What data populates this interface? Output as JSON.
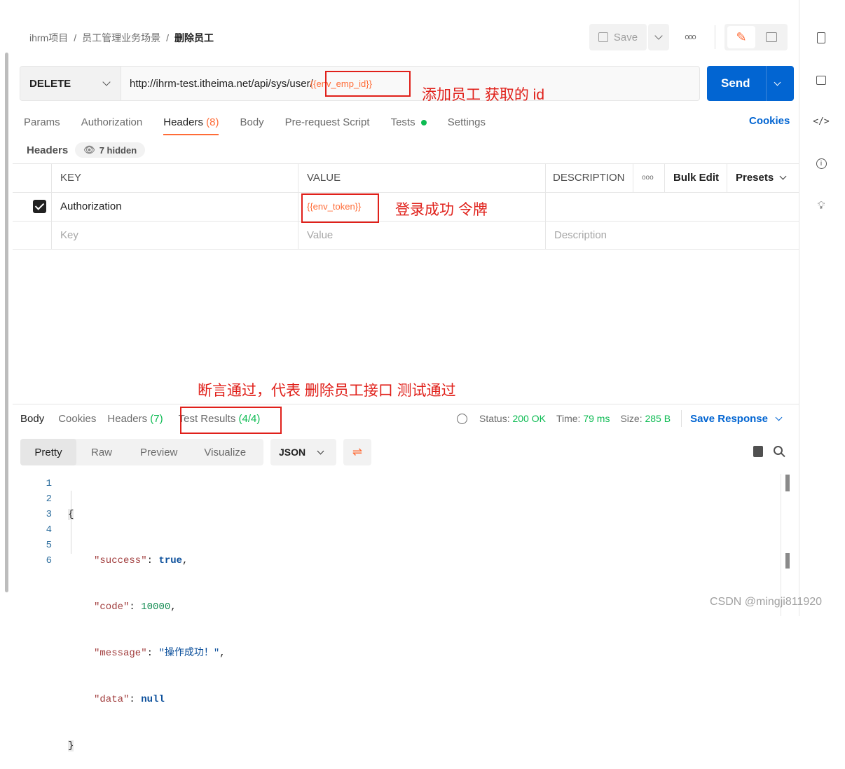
{
  "breadcrumb": {
    "p1": "ihrm项目",
    "sep": "/",
    "p2": "员工管理业务场景",
    "p3": "删除员工"
  },
  "toolbar": {
    "save": "Save",
    "more": "ooo"
  },
  "request": {
    "method": "DELETE",
    "url_base": "http://ihrm-test.itheima.net/api/sys/user/",
    "url_var": "{{env_emp_id}}",
    "send": "Send"
  },
  "annotations": {
    "id_note": "添加员工 获取的 id",
    "token_note": "登录成功 令牌",
    "test_note": "断言通过，代表 删除员工接口 测试通过"
  },
  "req_tabs": [
    "Params",
    "Authorization",
    "Headers",
    "(8)",
    "Body",
    "Pre-request Script",
    "Tests",
    "Settings"
  ],
  "cookies": "Cookies",
  "headers_bar": {
    "label": "Headers",
    "hidden": "7 hidden"
  },
  "table": {
    "key": "KEY",
    "value": "VALUE",
    "description": "DESCRIPTION",
    "more": "ooo",
    "bulk": "Bulk Edit",
    "presets": "Presets",
    "row_key": "Authorization",
    "row_value": "{{env_token}}",
    "ph_key": "Key",
    "ph_value": "Value",
    "ph_desc": "Description"
  },
  "resp_tabs": {
    "body": "Body",
    "cookies": "Cookies",
    "headers": "Headers",
    "headers_count": "(7)",
    "tests": "Test Results",
    "tests_count": "(4/4)"
  },
  "status": {
    "status_label": "Status:",
    "status": "200 OK",
    "time_label": "Time:",
    "time": "79 ms",
    "size_label": "Size:",
    "size": "285 B",
    "save_response": "Save Response"
  },
  "view_tabs": {
    "pretty": "Pretty",
    "raw": "Raw",
    "preview": "Preview",
    "visualize": "Visualize",
    "format": "JSON"
  },
  "code": {
    "lines": [
      "1",
      "2",
      "3",
      "4",
      "5",
      "6"
    ],
    "open": "{",
    "k1": "\"success\"",
    "v1": "true",
    "k2": "\"code\"",
    "v2": "10000",
    "k3": "\"message\"",
    "v3": "\"操作成功！\"",
    "k4": "\"data\"",
    "v4": "null",
    "close": "}"
  },
  "watermark": "CSDN @mingji811920",
  "colors": {
    "accent": "#ff6c37",
    "send": "#0265d2",
    "annotation": "#e0201a",
    "ok": "#0cbb52"
  }
}
